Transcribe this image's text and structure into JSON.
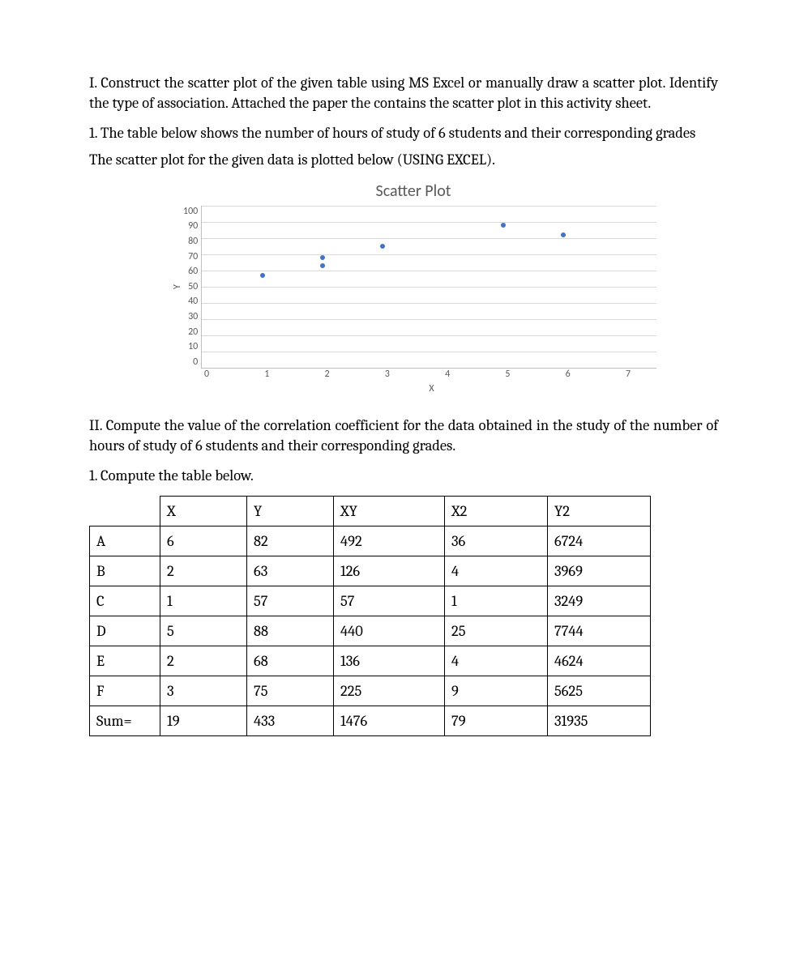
{
  "section_I": {
    "intro": "I. Construct the scatter plot of the given table using MS Excel or manually draw a scatter plot. Identify the type of association. Attached the paper the contains the scatter plot in this activity sheet.",
    "q1": "1. The table below shows the number of hours of study of 6 students and their corresponding grades",
    "caption": "The scatter plot for the given data is plotted below (USING EXCEL)."
  },
  "section_II": {
    "intro": "II. Compute the value of the correlation coefficient for the data obtained in the study of the number of hours of study of 6 students and their corresponding grades.",
    "q1": "1. Compute the table below."
  },
  "chart_data": {
    "type": "scatter",
    "title": "Scatter Plot",
    "xlabel": "X",
    "ylabel": "Y",
    "xlim": [
      0,
      7
    ],
    "ylim": [
      0,
      100
    ],
    "xticks": [
      0,
      1,
      2,
      3,
      4,
      5,
      6,
      7
    ],
    "yticks": [
      100,
      90,
      80,
      70,
      60,
      50,
      40,
      30,
      20,
      10,
      0
    ],
    "points": [
      {
        "x": 1,
        "y": 57
      },
      {
        "x": 2,
        "y": 63
      },
      {
        "x": 2,
        "y": 68
      },
      {
        "x": 3,
        "y": 75
      },
      {
        "x": 5,
        "y": 88
      },
      {
        "x": 6,
        "y": 82
      }
    ]
  },
  "table": {
    "headers": {
      "label": "",
      "x": "X",
      "y": "Y",
      "xy": "XY",
      "x2": "X2",
      "y2": "Y2"
    },
    "rows": [
      {
        "label": "A",
        "x": "6",
        "y": "82",
        "xy": "492",
        "x2": "36",
        "y2": "6724"
      },
      {
        "label": "B",
        "x": "2",
        "y": "63",
        "xy": "126",
        "x2": "4",
        "y2": "3969"
      },
      {
        "label": "C",
        "x": "1",
        "y": "57",
        "xy": "57",
        "x2": "1",
        "y2": "3249"
      },
      {
        "label": "D",
        "x": "5",
        "y": "88",
        "xy": "440",
        "x2": "25",
        "y2": "7744"
      },
      {
        "label": "E",
        "x": "2",
        "y": "68",
        "xy": "136",
        "x2": "4",
        "y2": "4624"
      },
      {
        "label": "F",
        "x": "3",
        "y": "75",
        "xy": "225",
        "x2": "9",
        "y2": "5625"
      }
    ],
    "sum": {
      "label": "Sum=",
      "x": "19",
      "y": "433",
      "xy": "1476",
      "x2": "79",
      "y2": "31935"
    }
  }
}
